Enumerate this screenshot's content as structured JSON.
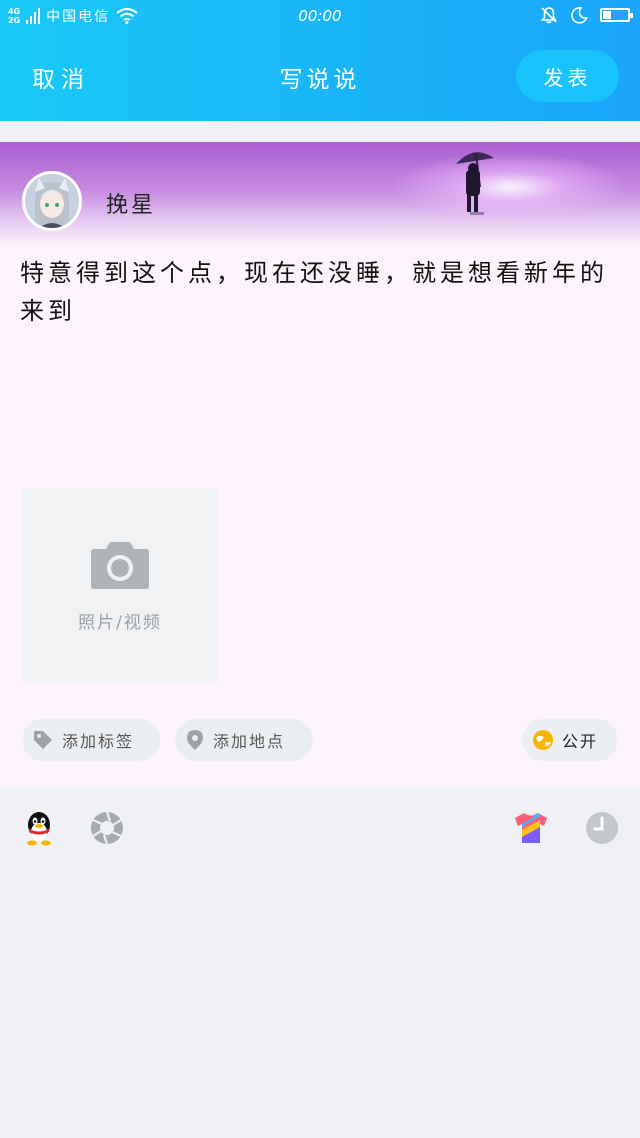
{
  "status_bar": {
    "network_top": "4G",
    "network_bottom": "2G",
    "carrier": "中国电信",
    "time": "00:00",
    "battery_level": 0.35
  },
  "nav": {
    "cancel_label": "取消",
    "title": "写说说",
    "publish_label": "发表"
  },
  "post": {
    "username": "挽星",
    "text": "特意得到这个点，现在还没睡，就是想看新年的来到",
    "photo_label": "照片/视频"
  },
  "chips": {
    "tag_label": "添加标签",
    "location_label": "添加地点",
    "privacy_label": "公开"
  },
  "toolbar": {
    "icons": [
      "qq-penguin-icon",
      "aperture-icon",
      "theme-shirt-icon",
      "clock-icon"
    ]
  },
  "colors": {
    "header_accent": "#1ab4f8",
    "publish_button": "#19c3fb",
    "card_background": "#fdf3fa",
    "privacy_icon": "#f5b400"
  }
}
